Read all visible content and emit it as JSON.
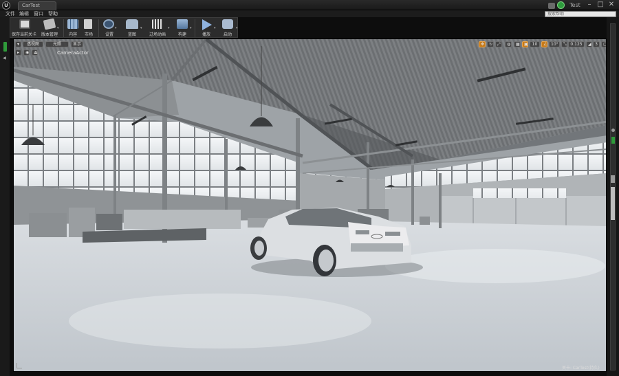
{
  "titlebar": {
    "logo": "U",
    "tab_label": "CarTest",
    "project_name": "Test",
    "minimize": "–",
    "maximize": "□",
    "close": "✕"
  },
  "menu": {
    "items": [
      "文件",
      "编辑",
      "窗口",
      "帮助"
    ]
  },
  "help_search": {
    "placeholder": "搜索帮助"
  },
  "toolbar": {
    "buttons": [
      {
        "label": "保存当前关卡",
        "icon": "save-icon",
        "color": "#d9d9d9"
      },
      {
        "label": "版本管理",
        "icon": "source-control-icon",
        "color": "#c9c9c9"
      },
      {
        "label": "内容",
        "icon": "content-icon",
        "color": "#9bb7d6"
      },
      {
        "label": "市场",
        "icon": "marketplace-icon",
        "color": "#c9c9c9"
      },
      {
        "label": "设置",
        "icon": "settings-icon",
        "color": "#8fa6c0"
      },
      {
        "label": "蓝图",
        "icon": "blueprint-icon",
        "color": "#b5c6d8"
      },
      {
        "label": "过场动画",
        "icon": "cinematics-icon",
        "color": "#d0d0d0"
      },
      {
        "label": "构建",
        "icon": "build-icon",
        "color": "#9bb7d6"
      },
      {
        "label": "播放",
        "icon": "play-icon",
        "color": "#8fb3e0"
      },
      {
        "label": "启动",
        "icon": "launch-icon",
        "color": "#b5c6d8"
      }
    ]
  },
  "viewport": {
    "mode_label": "透视图",
    "view_label": "光照",
    "show_label": "显示",
    "realtime_label": "CameraActor",
    "grid_snap": "10",
    "rot_snap": "10°",
    "scale_snap": "0.125",
    "camera_speed": "3",
    "level_label": "关卡: CarTest(持久)"
  },
  "colors": {
    "accent": "#c77a18",
    "ue_green": "#2f9a3a",
    "panel": "#2c2c2c"
  }
}
